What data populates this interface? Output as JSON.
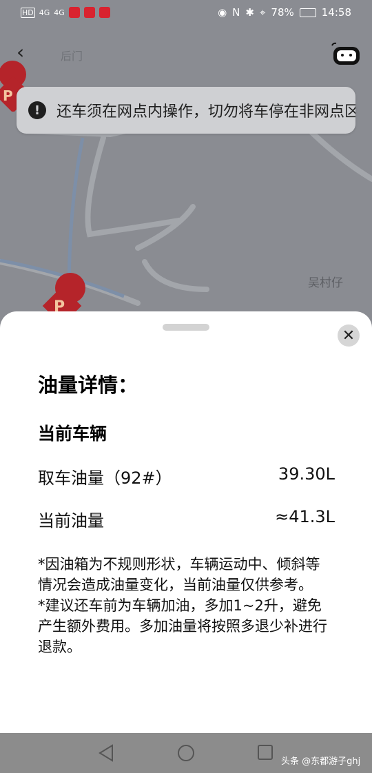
{
  "status_bar": {
    "signal_left": "HD",
    "net1": "4G",
    "net2": "4G",
    "battery": "78%",
    "time": "14:58"
  },
  "map": {
    "road_label": "后门",
    "place_label": "吴村仔",
    "parking_marker": "P",
    "notice": "还车须在网点内操作，切勿将车停在非网点区域"
  },
  "sheet": {
    "title": "油量详情：",
    "section": "当前车辆",
    "rows": [
      {
        "label": "取车油量（92#）",
        "value": "39.30L"
      },
      {
        "label": "当前油量",
        "value": "≈41.3L"
      }
    ],
    "notes": [
      "*因油箱为不规则形状，车辆运动中、倾斜等情况会造成油量变化，当前油量仅供参考。",
      "*建议还车前为车辆加油，多加1~2升，避免产生额外费用。多加油量将按照多退少补进行退款。"
    ],
    "close_glyph": "✕"
  },
  "watermark": "头条 @东都游子ghj"
}
